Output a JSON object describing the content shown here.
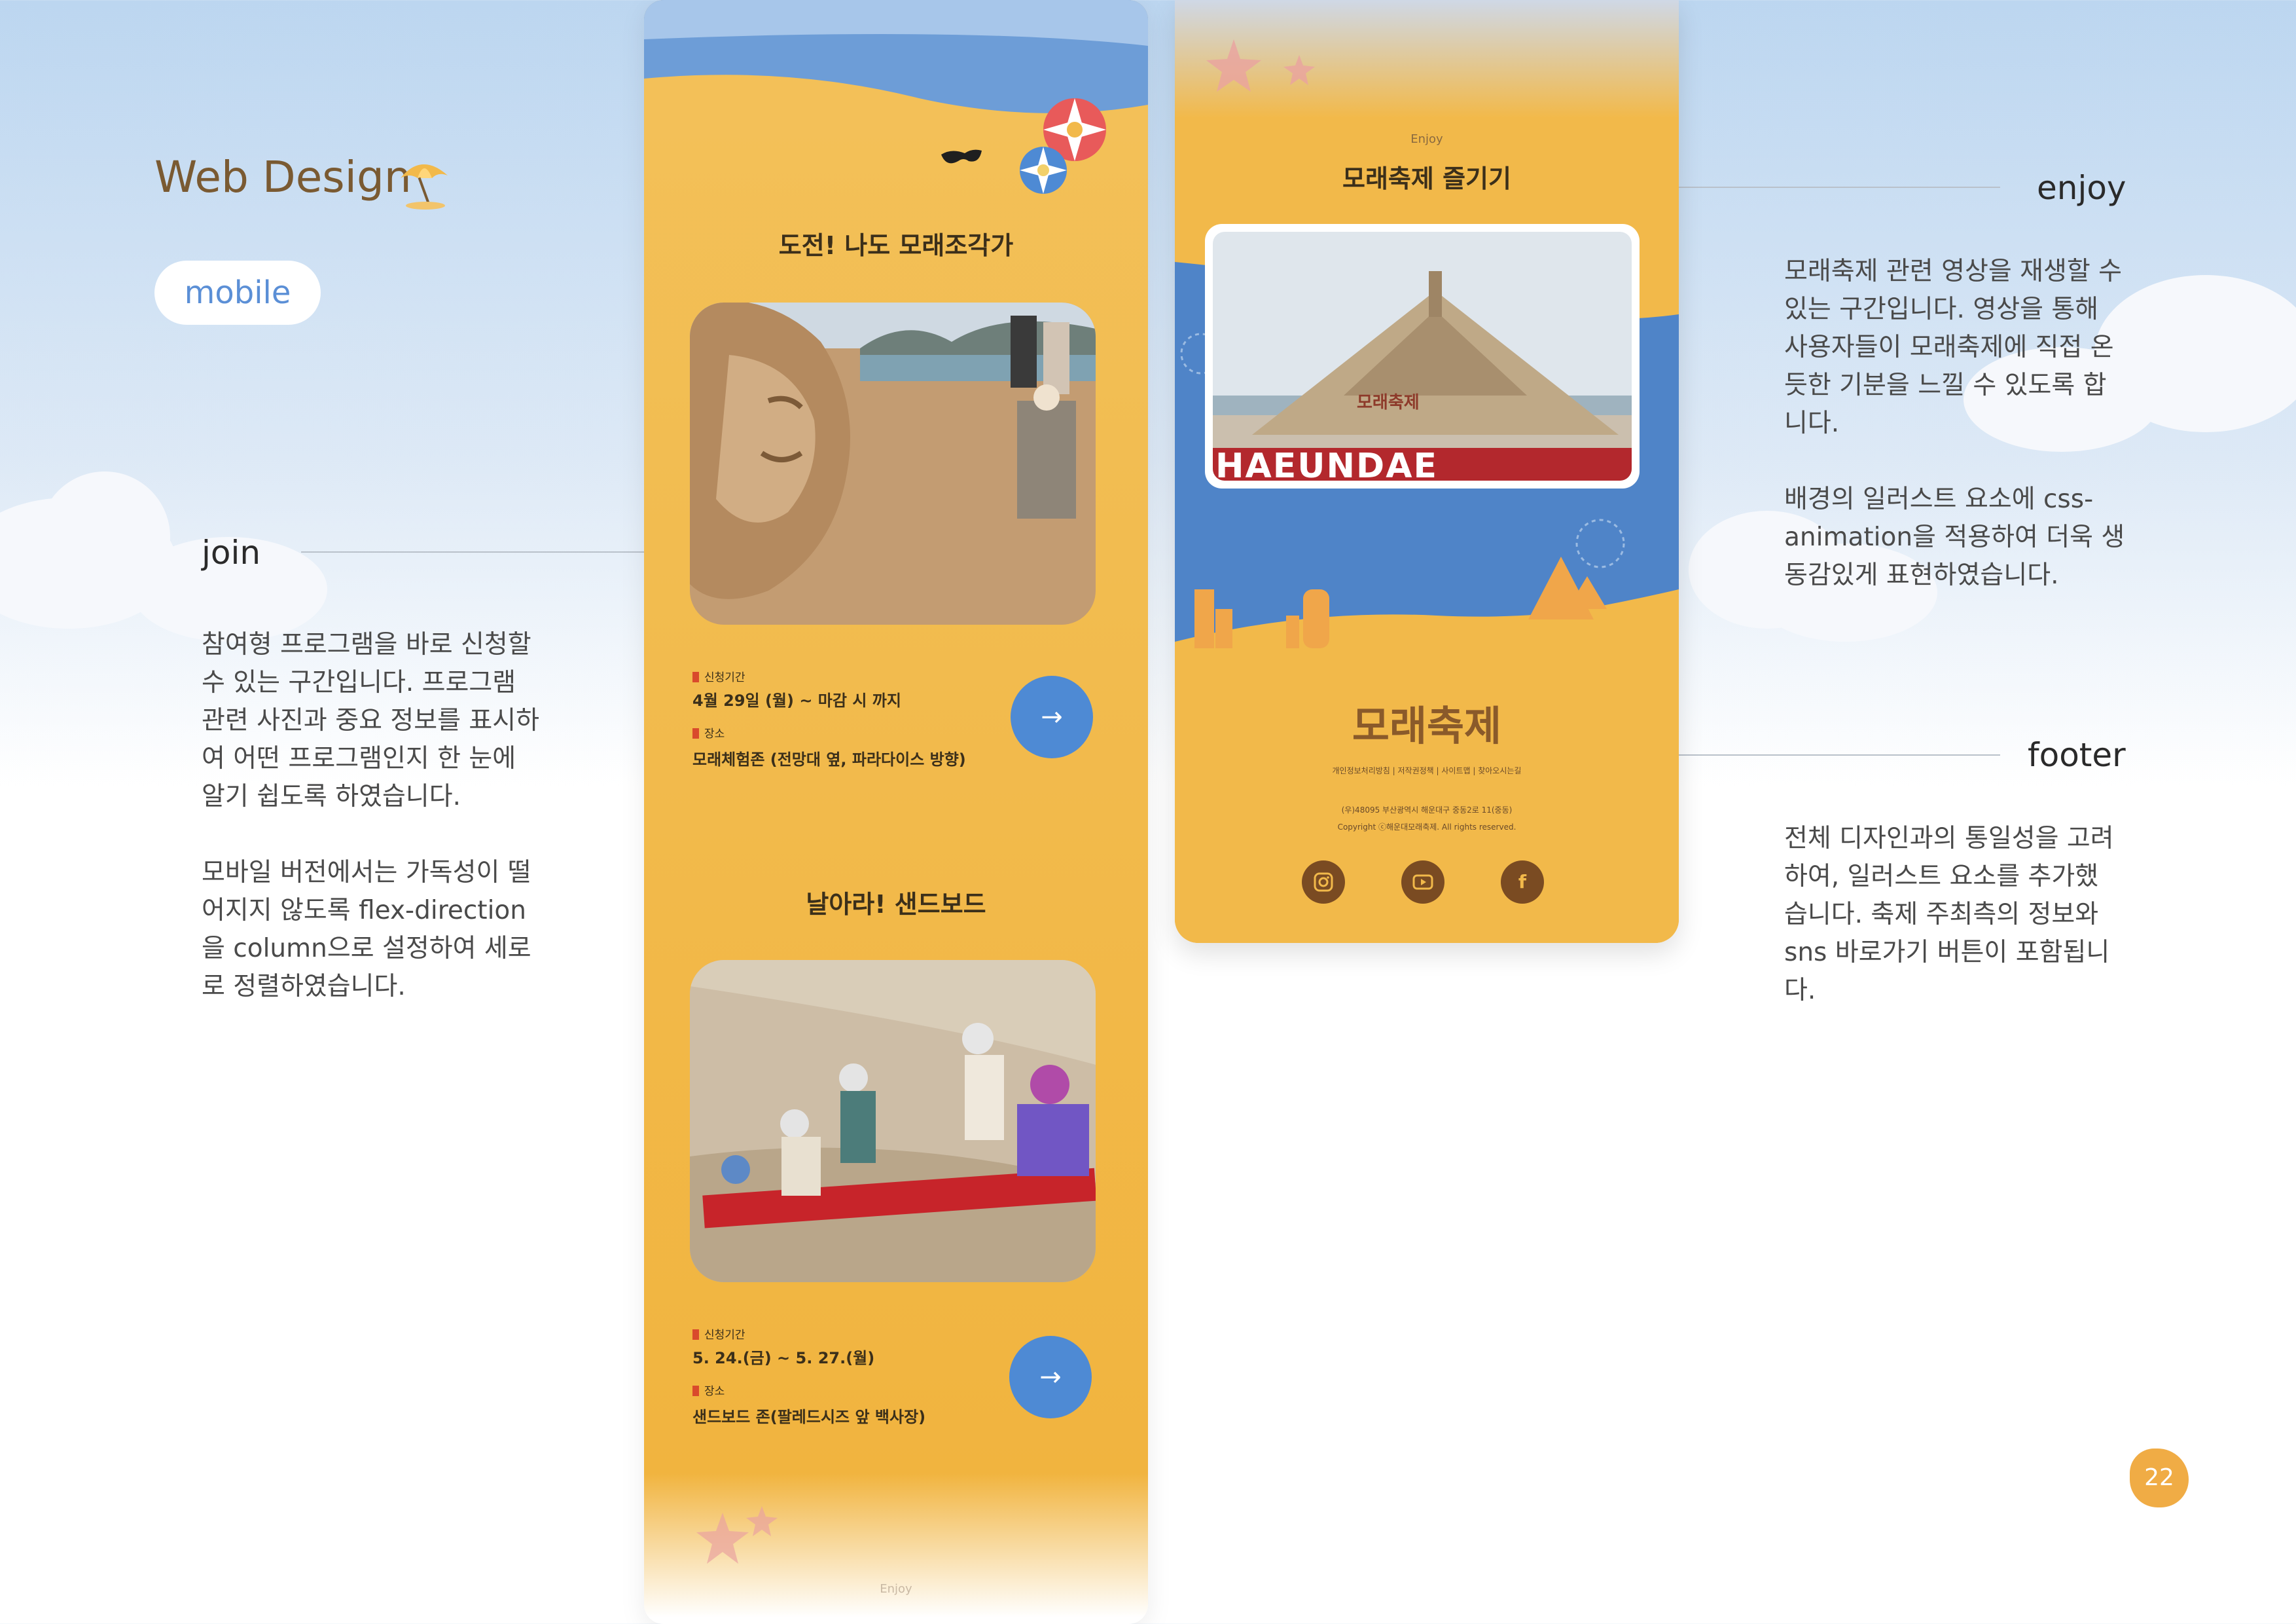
{
  "header": {
    "title": "Web Design",
    "badge": "mobile",
    "icon": "beach-umbrella-icon"
  },
  "join": {
    "label": "join",
    "description_1": [
      "참여형 프로그램을 바로 신청할",
      "수 있는 구간입니다. 프로그램",
      "관련 사진과 중요 정보를 표시하",
      "여 어떤 프로그램인지 한 눈에",
      "알기 쉽도록 하였습니다."
    ],
    "description_2": [
      "모바일 버전에서는 가독성이 떨",
      "어지지 않도록 flex-direction",
      "을 column으로 설정하여 세로",
      "로 정렬하였습니다."
    ]
  },
  "enjoy": {
    "label": "enjoy",
    "description_1": [
      "모래축제 관련 영상을 재생할 수",
      "있는 구간입니다. 영상을 통해",
      "사용자들이 모래축제에 직접 온",
      "듯한 기분을 느낄 수 있도록 합",
      "니다."
    ],
    "description_2": [
      "배경의 일러스트 요소에 css-",
      "animation을 적용하여 더욱 생",
      "동감있게 표현하였습니다."
    ]
  },
  "footer": {
    "label": "footer",
    "description": [
      "전체 디자인과의 통일성을 고려",
      "하여, 일러스트 요소를 추가했",
      "습니다. 축제 주최측의 정보와",
      "sns 바로가기 버튼이 포함됩니",
      "다."
    ]
  },
  "phone1": {
    "program1": {
      "title": "도전! 나도 모래조각가",
      "period_label": "신청기간",
      "period": "4월 29일 (월) ~ 마감 시 까지",
      "place_label": "장소",
      "place": "모래체험존 (전망대 옆, 파라다이스 방향)",
      "button": "→"
    },
    "program2": {
      "title": "날아라! 샌드보드",
      "period_label": "신청기간",
      "period": "5. 24.(금) ~ 5. 27.(월)",
      "place_label": "장소",
      "place": "샌드보드 존(팔레드시즈 앞 백사장)",
      "button": "→"
    },
    "enjoy_caption": "Enjoy"
  },
  "phone2": {
    "enjoy_caption": "Enjoy",
    "enjoy_title": "모래축제 즐기기",
    "video_text": "HAEUNDAE",
    "sculpture_text": "모래축제",
    "logo": "모래축제",
    "footer_links": "개인정보처리방침 | 저작권정책 | 사이트맵 | 찾아오시는길",
    "address": "(우)48095 부산광역시 해운대구 중동2로 11(중동)",
    "copyright": "Copyright ⓒ해운대모래축제. All rights reserved.",
    "sns": [
      "instagram-icon",
      "youtube-icon",
      "facebook-icon"
    ],
    "facebook_glyph": "f"
  },
  "page_number": "22",
  "colors": {
    "sand": "#f2b94a",
    "sea": "#4e8ad4",
    "brown": "#7a5a32",
    "accent": "#f0ac45"
  }
}
